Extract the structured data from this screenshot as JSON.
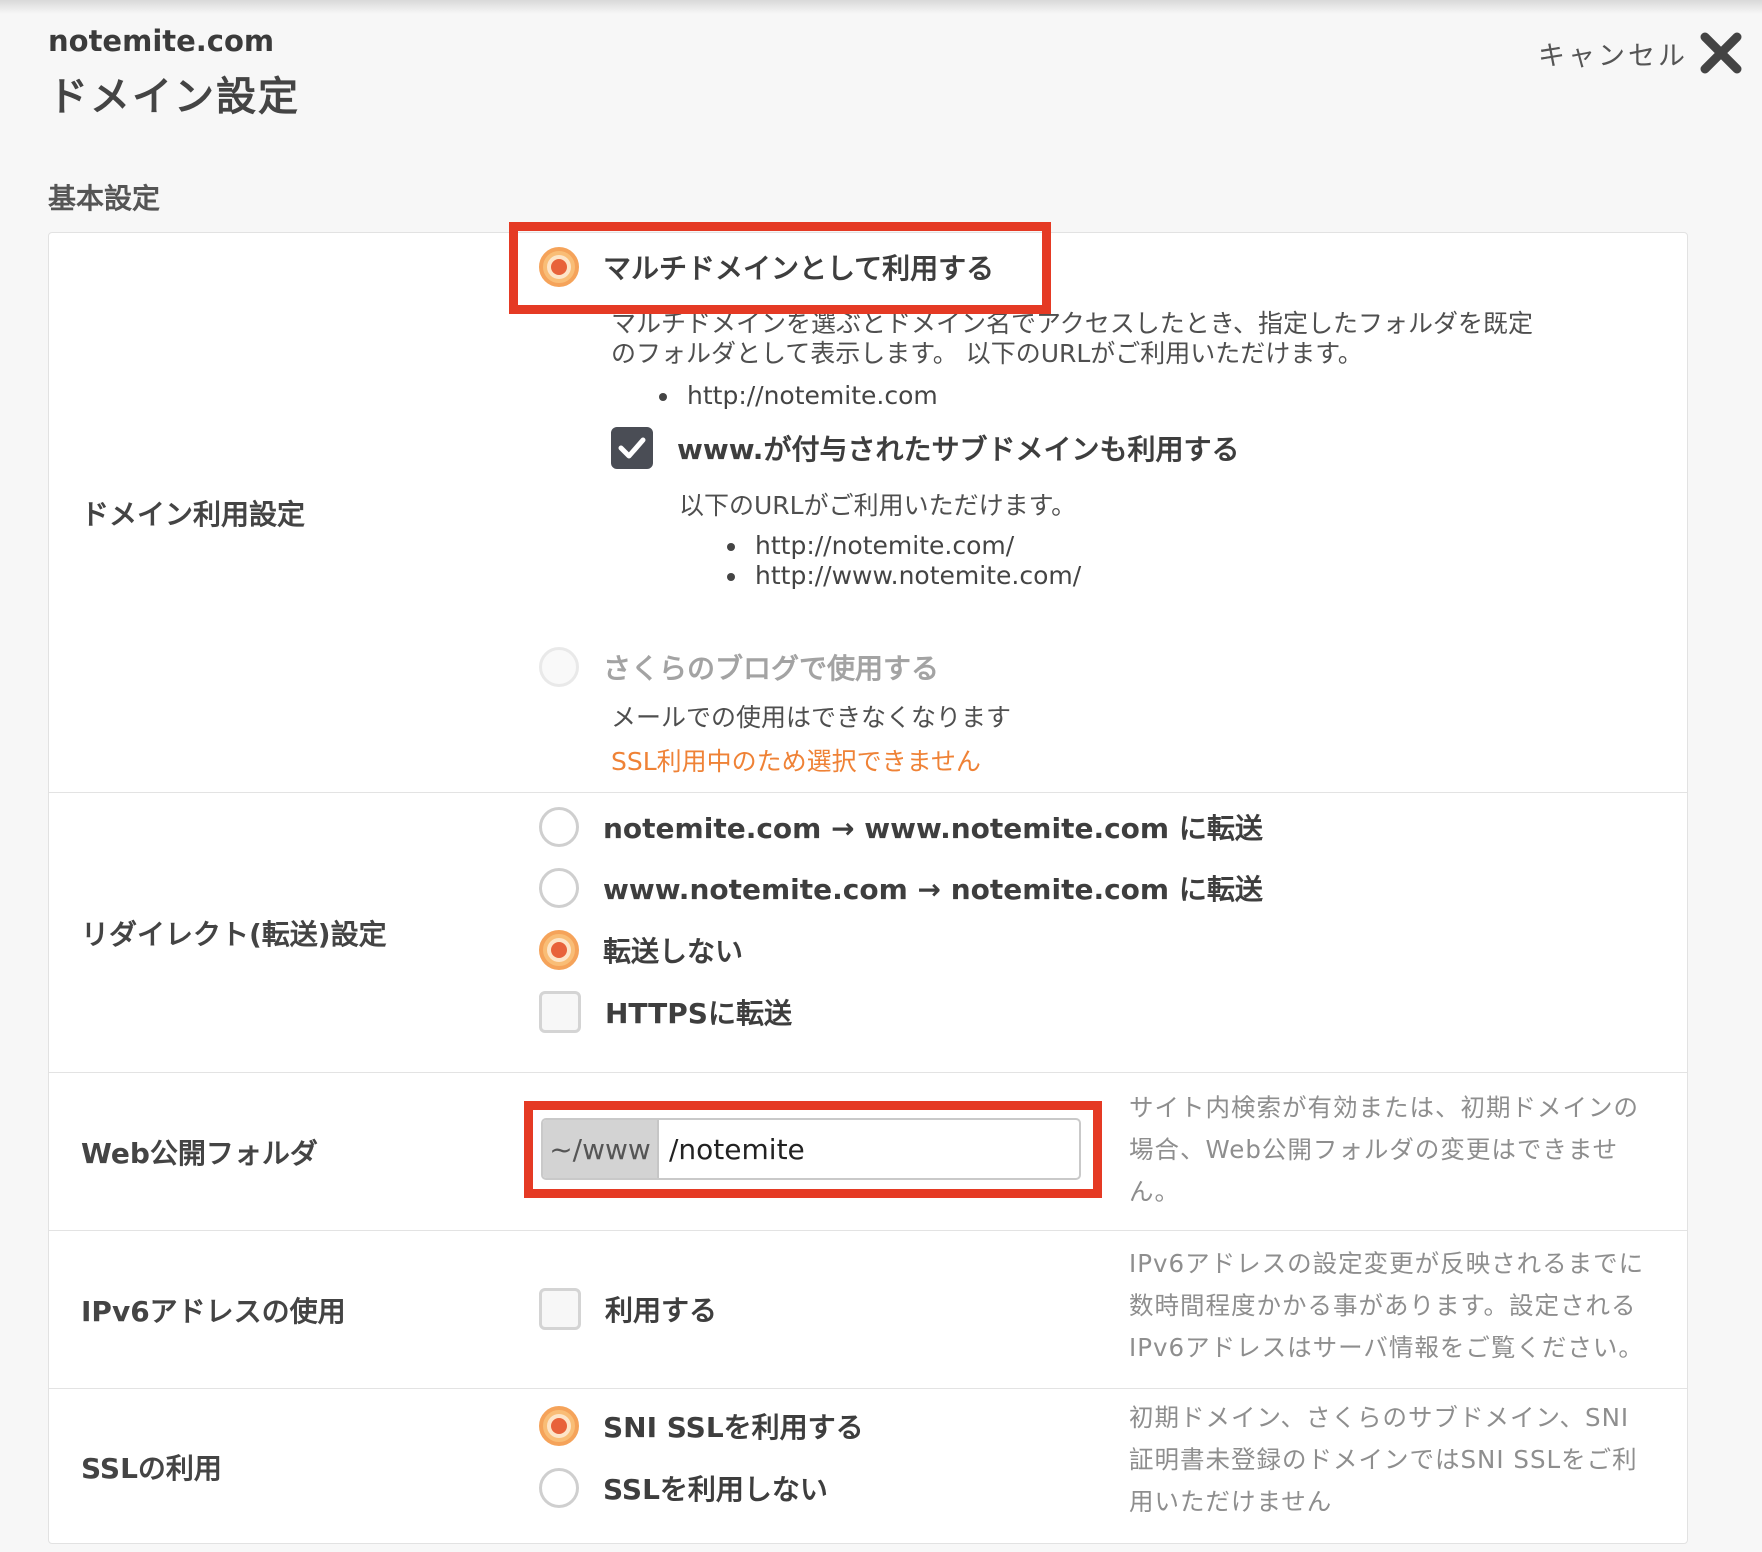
{
  "header": {
    "domain": "notemite.com",
    "title": "ドメイン設定",
    "cancel_label": "キャンセル"
  },
  "section_title": "基本設定",
  "domain_usage": {
    "label": "ドメイン利用設定",
    "multi_option": {
      "label": "マルチドメインとして利用する",
      "selected": true,
      "desc_line1": "マルチドメインを選ぶとドメイン名でアクセスしたとき、指定したフォルダを既定",
      "desc_line2": "のフォルダとして表示します。 以下のURLがご利用いただけます。",
      "url": "http://notemite.com"
    },
    "www_checkbox": {
      "label": "www.が付与されたサブドメインも利用する",
      "checked": true,
      "desc": "以下のURLがご利用いただけます。",
      "urls": [
        "http://notemite.com/",
        "http://www.notemite.com/"
      ]
    },
    "blog_option": {
      "label": "さくらのブログで使用する",
      "selected": false,
      "disabled": true,
      "desc": "メールでの使用はできなくなります",
      "warning": "SSL利用中のため選択できません"
    }
  },
  "redirect": {
    "label": "リダイレクト(転送)設定",
    "options": [
      {
        "label": "notemite.com → www.notemite.com に転送",
        "selected": false
      },
      {
        "label": "www.notemite.com → notemite.com に転送",
        "selected": false
      },
      {
        "label": "転送しない",
        "selected": true
      }
    ],
    "https_label": "HTTPSに転送",
    "https_checked": false
  },
  "web_folder": {
    "label": "Web公開フォルダ",
    "prefix": "~/www",
    "value": "/notemite",
    "help": [
      "サイト内検索が有効または、初期ドメインの",
      "場合、Web公開フォルダの変更はできませ",
      "ん。"
    ]
  },
  "ipv6": {
    "label": "IPv6アドレスの使用",
    "checkbox_label": "利用する",
    "checked": false,
    "help": [
      "IPv6アドレスの設定変更が反映されるまでに",
      "数時間程度かかる事があります。設定される",
      "IPv6アドレスはサーバ情報をご覧ください。"
    ]
  },
  "ssl": {
    "label": "SSLの利用",
    "options": [
      {
        "label": "SNI SSLを利用する",
        "selected": true
      },
      {
        "label": "SSLを利用しない",
        "selected": false
      }
    ],
    "help": [
      "初期ドメイン、さくらのサブドメイン、SNI",
      "証明書未登録のドメインではSNI SSLをご利",
      "用いただけません"
    ]
  },
  "colors": {
    "highlight": "#e53a24",
    "radio_selected": "#f5a35a",
    "warning": "#ef8236"
  }
}
